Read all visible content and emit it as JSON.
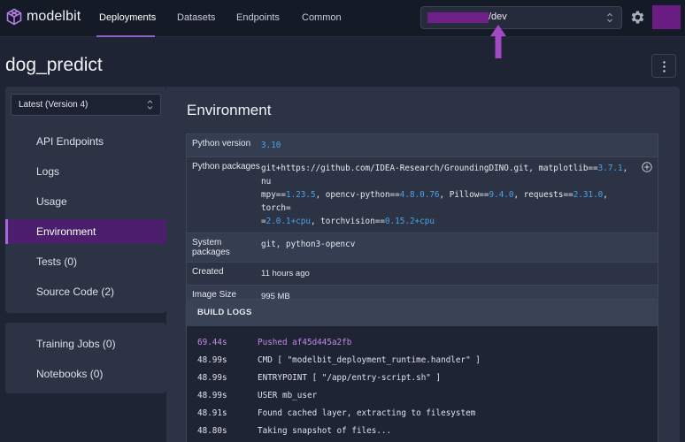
{
  "app": {
    "logo_text": "modelbit",
    "nav_tabs": [
      {
        "label": "Deployments",
        "active": true
      },
      {
        "label": "Datasets"
      },
      {
        "label": "Endpoints"
      },
      {
        "label": "Common"
      }
    ],
    "branch_select": {
      "value": "/dev",
      "redacted_color": "#6f1f88"
    },
    "icons": [
      "modelbit-logo-icon",
      "chevron-updown-icon",
      "gear-icon",
      "arrow-up-icon",
      "kebab-icon",
      "plus-circle-icon"
    ]
  },
  "page": {
    "title": "dog_predict"
  },
  "sidebar": {
    "version_select": "Latest (Version 4)",
    "items": [
      {
        "label": "API Endpoints"
      },
      {
        "label": "Logs"
      },
      {
        "label": "Usage"
      },
      {
        "label": "Environment",
        "active": true
      },
      {
        "label": "Tests (0)"
      },
      {
        "label": "Source Code (2)"
      }
    ],
    "secondary_items": [
      {
        "label": "Training Jobs (0)"
      },
      {
        "label": "Notebooks (0)"
      }
    ]
  },
  "environment": {
    "title": "Environment",
    "python_version_label": "Python version",
    "python_version": "3.10",
    "packages_label": "Python packages",
    "packages": {
      "p1": "git+https://github.com/IDEA-Research/GroundingDINO.git, matplotlib==",
      "v1": "3.7.1",
      "p2": ", nu",
      "p3": "mpy==",
      "v2": "1.23.5",
      "p4": ", opencv-python==",
      "v3": "4.8.0.76",
      "p5": ", Pillow==",
      "v4": "9.4.0",
      "p6": ", requests==",
      "v5": "2.31.0",
      "p7": ", torch=",
      "p8": "=",
      "v6": "2.0.1+cpu",
      "p9": ", torchvision==",
      "v7": "0.15.2+cpu"
    },
    "system_packages_label": "System packages",
    "system_packages": "git, python3-opencv",
    "created_label": "Created",
    "created": "11 hours ago",
    "image_size_label": "Image Size",
    "image_size": "995 MB"
  },
  "build_logs": {
    "title": "BUILD LOGS",
    "lines": [
      {
        "time": "69.44s",
        "msg": "Pushed af45d445a2fb",
        "highlight": true
      },
      {
        "time": "48.99s",
        "msg": "CMD [ \"modelbit_deployment_runtime.handler\" ]"
      },
      {
        "time": "48.99s",
        "msg": "ENTRYPOINT [ \"/app/entry-script.sh\" ]"
      },
      {
        "time": "48.99s",
        "msg": "USER mb_user"
      },
      {
        "time": "48.91s",
        "msg": "Found cached layer, extracting to filesystem"
      },
      {
        "time": "48.80s",
        "msg": "Taking snapshot of files..."
      }
    ]
  },
  "colors": {
    "accent": "#8f5fc6",
    "active_bg": "#4b1f6b",
    "version_blue": "#4aa3e8",
    "log_highlight": "#c48ae8"
  }
}
